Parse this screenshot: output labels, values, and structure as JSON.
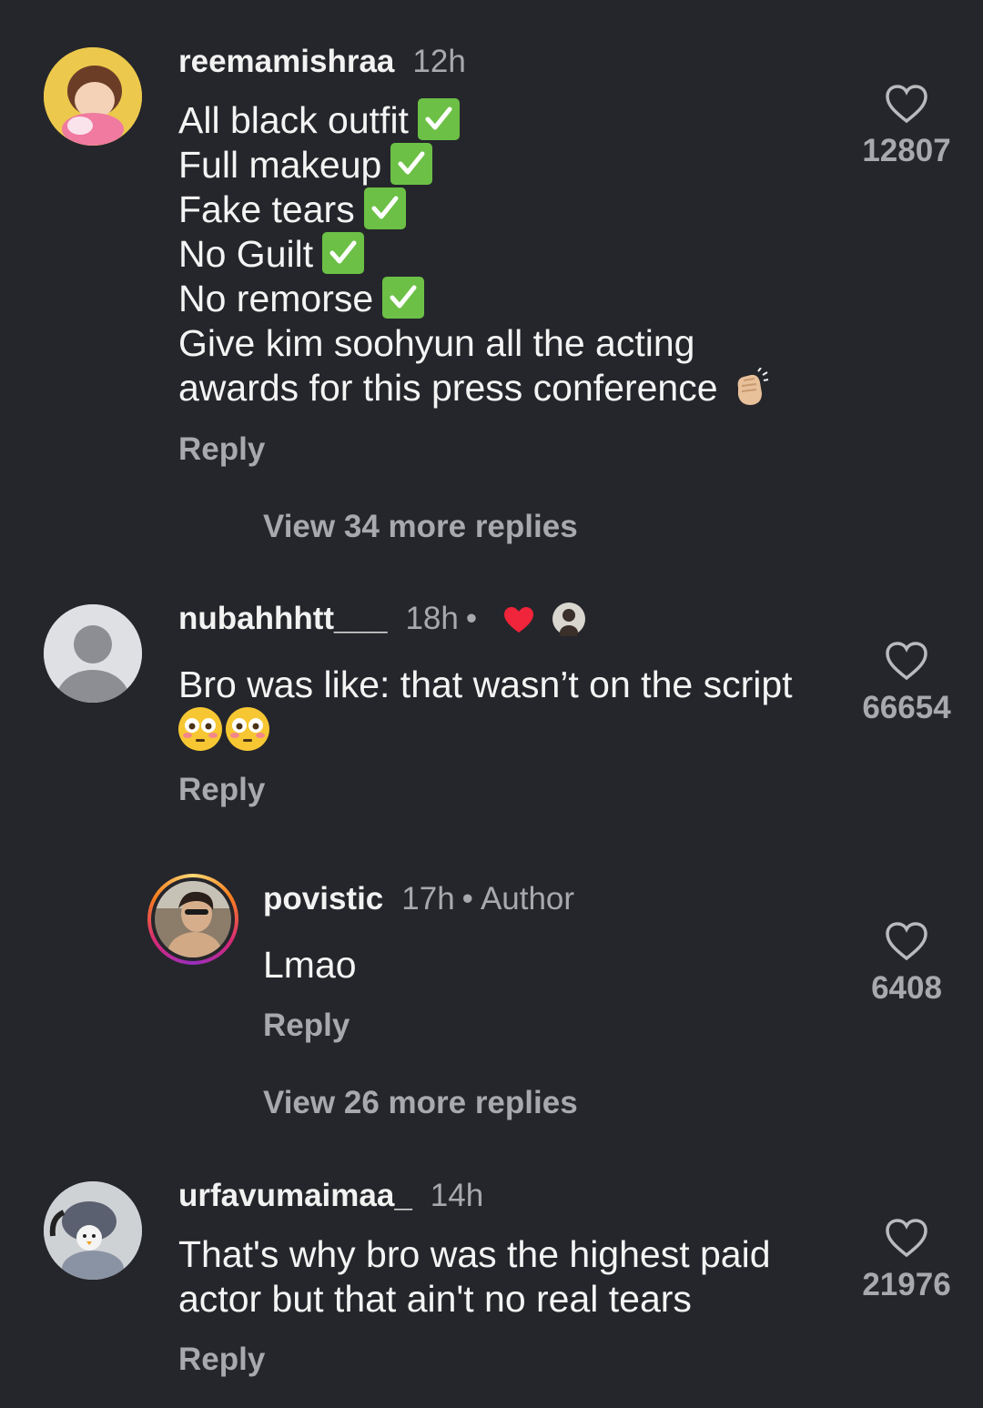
{
  "comments": [
    {
      "username": "reemamishraa",
      "time": "12h",
      "lines": [
        "All black outfit",
        "Full makeup",
        "Fake tears",
        "No Guilt",
        "No remorse",
        "Give kim soohyun all the acting",
        "awards for this press conference"
      ],
      "reply": "Reply",
      "view_more": "View 34 more replies",
      "likes": "12807"
    },
    {
      "username": "nubahhhtt___",
      "time": "18h",
      "separator": "•",
      "text": "Bro was like: that wasn’t on the script",
      "reply": "Reply",
      "likes": "66654"
    },
    {
      "username": "povistic",
      "time": "17h",
      "separator": "•",
      "author_label": "Author",
      "text": "Lmao",
      "reply": "Reply",
      "view_more": "View 26 more replies",
      "likes": "6408"
    },
    {
      "username": "urfavumaimaa_",
      "time": "14h",
      "lines": [
        "That's why bro was the highest paid",
        "actor but that ain't no real tears"
      ],
      "reply": "Reply",
      "likes": "21976"
    }
  ],
  "icons": {
    "like": "heart-outline-icon",
    "check": "check-mark-button-emoji",
    "clap": "clapping-hands-emoji",
    "flushed": "flushed-face-emoji",
    "creator_liked": "red-heart-icon"
  },
  "colors": {
    "background": "#25262b",
    "muted_text": "#a8a9ad",
    "check_green": "#6cc046",
    "heart_red": "#f0243a"
  }
}
